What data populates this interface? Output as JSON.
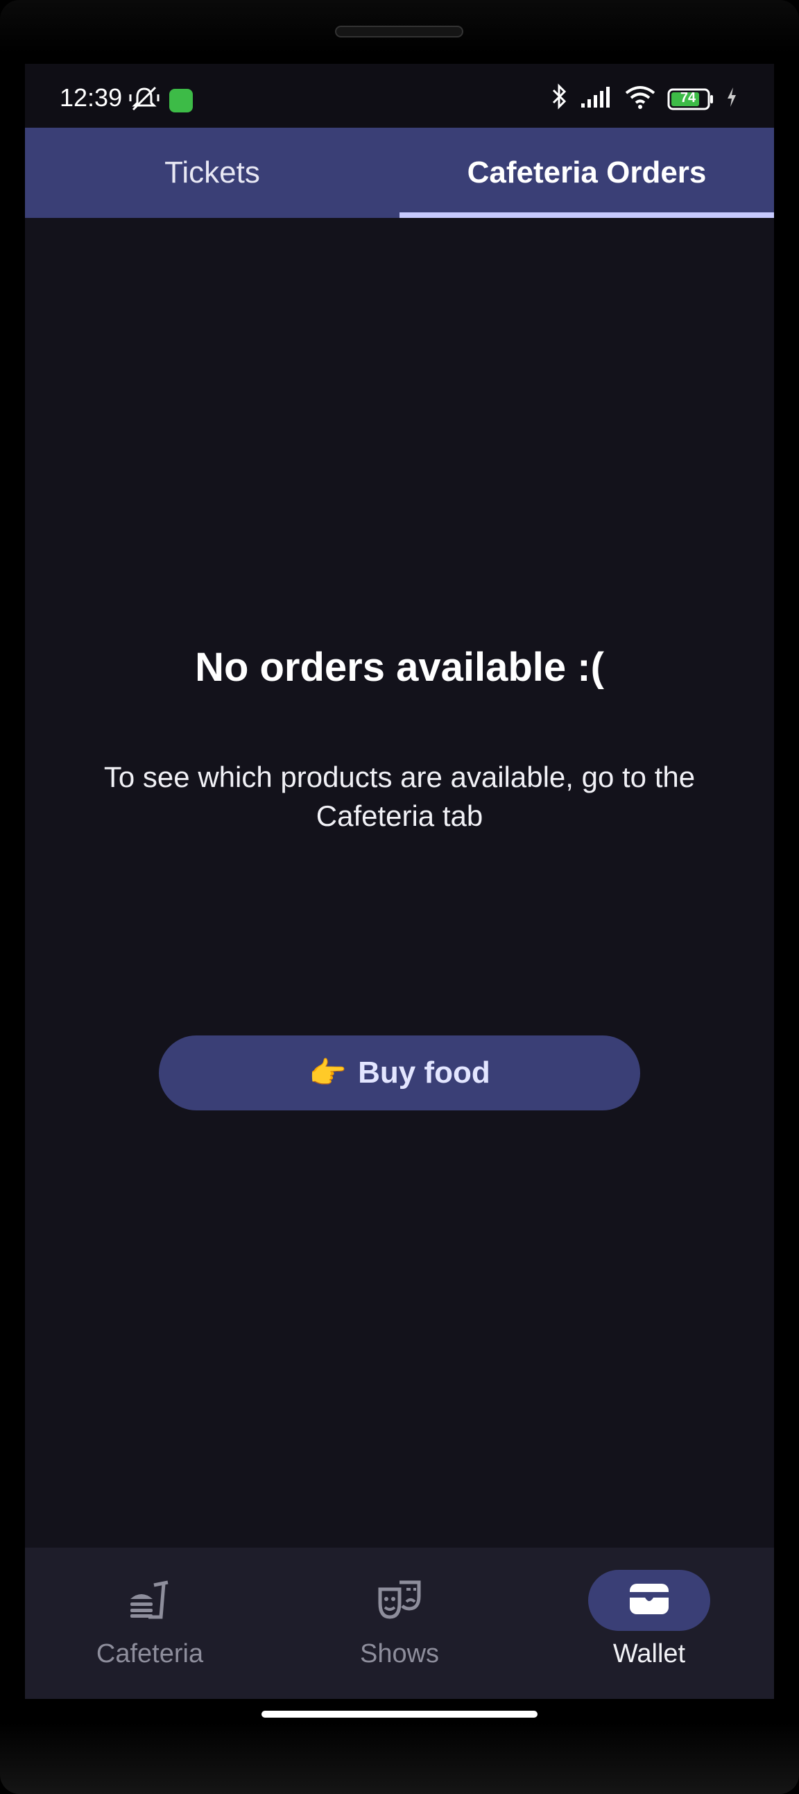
{
  "status_bar": {
    "time": "12:39",
    "battery": "74"
  },
  "tabs": [
    {
      "label": "Tickets",
      "active": false
    },
    {
      "label": "Cafeteria Orders",
      "active": true
    }
  ],
  "empty_state": {
    "title": "No orders available :(",
    "description": "To see which products are available, go to the Cafeteria tab",
    "button_emoji": "👉",
    "button_label": "Buy food"
  },
  "bottom_nav": [
    {
      "label": "Cafeteria",
      "icon": "fastfood-icon",
      "active": false
    },
    {
      "label": "Shows",
      "icon": "theater-masks-icon",
      "active": false
    },
    {
      "label": "Wallet",
      "icon": "wallet-icon",
      "active": true
    }
  ],
  "colors": {
    "background": "#13121b",
    "primary": "#3a3f76",
    "tab_indicator": "#c8cbff",
    "nav_background": "#1e1d2a"
  }
}
